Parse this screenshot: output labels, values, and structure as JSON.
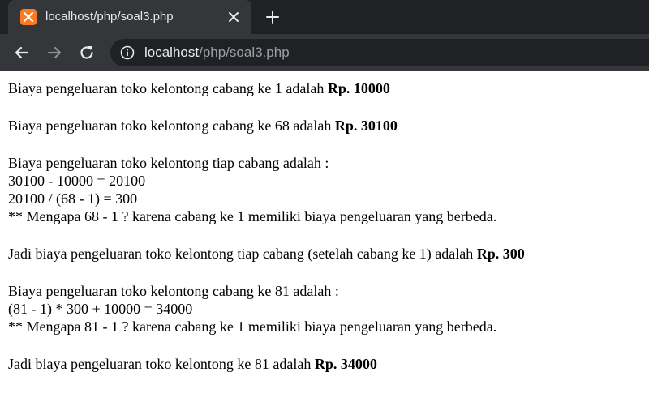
{
  "browser": {
    "tab_title": "localhost/php/soal3.php",
    "url_host": "localhost",
    "url_path": "/php/soal3.php",
    "icons": {
      "favicon": "xampp-icon",
      "close": "close-icon",
      "new_tab": "plus-icon",
      "back": "back-arrow-icon",
      "forward": "forward-arrow-icon",
      "reload": "reload-icon",
      "site_info": "info-icon"
    }
  },
  "content": {
    "p1_text": "Biaya pengeluaran toko kelontong cabang ke 1 adalah ",
    "p1_value": "Rp. 10000",
    "p2_text": "Biaya pengeluaran toko kelontong cabang ke 68 adalah ",
    "p2_value": "Rp. 30100",
    "p3_lines": [
      "Biaya pengeluaran toko kelontong tiap cabang adalah :",
      "30100 - 10000 = 20100",
      "20100 / (68 - 1) = 300",
      "** Mengapa 68 - 1 ? karena cabang ke 1 memiliki biaya pengeluaran yang berbeda."
    ],
    "p4_text": "Jadi biaya pengeluaran toko kelontong tiap cabang (setelah cabang ke 1) adalah ",
    "p4_value": "Rp. 300",
    "p5_lines": [
      "Biaya pengeluaran toko kelontong cabang ke 81 adalah :",
      "(81 - 1) * 300 + 10000 = 34000",
      "** Mengapa 81 - 1 ? karena cabang ke 1 memiliki biaya pengeluaran yang berbeda."
    ],
    "p6_text": "Jadi biaya pengeluaran toko kelontong ke 81 adalah ",
    "p6_value": "Rp. 34000"
  },
  "colors": {
    "tabstrip": "#202124",
    "toolbar": "#35363a",
    "favicon": "#fb7a24",
    "text_light": "#e8eaed",
    "text_dim": "#9aa0a6"
  }
}
